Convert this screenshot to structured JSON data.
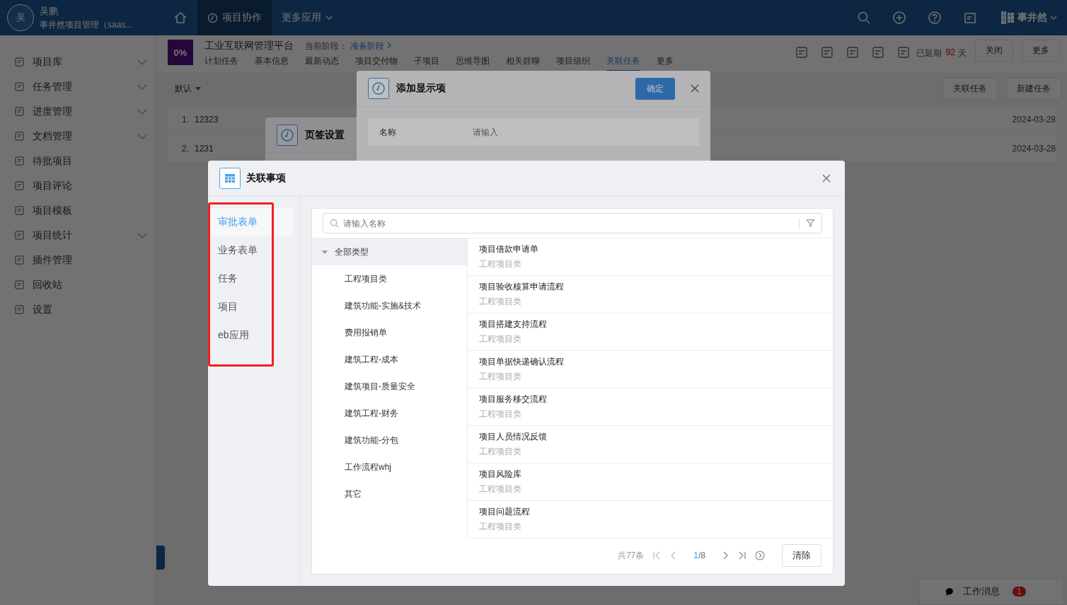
{
  "topbar": {
    "avatar": "吴",
    "user": "吴鹏",
    "company": "事井然项目管理（saas...",
    "nav": [
      {
        "label": "项目协作",
        "selected": true
      },
      {
        "label": "更多应用",
        "selected": false
      }
    ],
    "logo": "事井然"
  },
  "sidebar": {
    "items": [
      {
        "label": "项目库",
        "expandable": true
      },
      {
        "label": "任务管理",
        "expandable": true
      },
      {
        "label": "进度管理",
        "expandable": true
      },
      {
        "label": "文档管理",
        "expandable": true
      },
      {
        "label": "待批项目",
        "expandable": false
      },
      {
        "label": "项目评论",
        "expandable": false
      },
      {
        "label": "项目模板",
        "expandable": false
      },
      {
        "label": "项目统计",
        "expandable": true
      },
      {
        "label": "插件管理",
        "expandable": false
      },
      {
        "label": "回收站",
        "expandable": false
      },
      {
        "label": "设置",
        "expandable": false
      }
    ]
  },
  "project": {
    "progress": "0%",
    "title": "工业互联网管理平台",
    "stage_label": "当前阶段：",
    "stage": "准备阶段",
    "tabs": [
      {
        "label": "计划任务",
        "selected": false
      },
      {
        "label": "基本信息",
        "selected": false
      },
      {
        "label": "最新动态",
        "selected": false
      },
      {
        "label": "项目交付物",
        "selected": false
      },
      {
        "label": "子项目",
        "selected": false
      },
      {
        "label": "思维导图",
        "selected": false
      },
      {
        "label": "相关群聊",
        "selected": false
      },
      {
        "label": "项目组织",
        "selected": false
      },
      {
        "label": "关联任务",
        "selected": true
      },
      {
        "label": "更多",
        "selected": false
      }
    ],
    "delay_label": "已延期",
    "delay_days": "92",
    "delay_unit": "天",
    "buttons": [
      "关闭",
      "更多"
    ]
  },
  "toolbar": {
    "sort": "默认",
    "buttons": [
      "关联任务",
      "新建任务"
    ]
  },
  "tasks": [
    {
      "index": "1.",
      "name": "12323",
      "date": "2024-03-28"
    },
    {
      "index": "2.",
      "name": "1231",
      "date": "2024-03-28"
    }
  ],
  "messages": {
    "label": "工作消息",
    "count": "1"
  },
  "tab_settings_dialog": {
    "title": "页签设置"
  },
  "add_item_dialog": {
    "title": "添加显示项",
    "confirm": "确定",
    "fields": [
      {
        "label": "名称",
        "placeholder": "请输入"
      }
    ]
  },
  "link_dialog": {
    "title": "关联事项",
    "categories": [
      {
        "label": "审批表单",
        "selected": true
      },
      {
        "label": "业务表单",
        "selected": false
      },
      {
        "label": "任务",
        "selected": false
      },
      {
        "label": "项目",
        "selected": false
      },
      {
        "label": "eb应用",
        "selected": false
      }
    ],
    "search": {
      "placeholder": "请输入名称"
    },
    "tree": {
      "label": "全部类型",
      "expanded": true,
      "selected": true,
      "children": [
        {
          "label": "工程项目类",
          "selected": false
        },
        {
          "label": "建筑功能-实施&技术",
          "selected": false
        },
        {
          "label": "费用报销单",
          "selected": false
        },
        {
          "label": "建筑工程-成本",
          "selected": false
        },
        {
          "label": "建筑项目-质量安全",
          "selected": false
        },
        {
          "label": "建筑工程-财务",
          "selected": false
        },
        {
          "label": "建筑功能-分包",
          "selected": false
        },
        {
          "label": "工作流程whj",
          "selected": false
        },
        {
          "label": "其它",
          "selected": false
        }
      ]
    },
    "items": [
      {
        "title": "项目借款申请单",
        "type": "工程项目类"
      },
      {
        "title": "项目验收核算申请流程",
        "type": "工程项目类"
      },
      {
        "title": "项目搭建支持流程",
        "type": "工程项目类"
      },
      {
        "title": "项目单据快递确认流程",
        "type": "工程项目类"
      },
      {
        "title": "项目服务移交流程",
        "type": "工程项目类"
      },
      {
        "title": "项目人员情况反馈",
        "type": "工程项目类"
      },
      {
        "title": "项目风险库",
        "type": "工程项目类"
      },
      {
        "title": "项目问题流程",
        "type": "工程项目类"
      }
    ],
    "pagination": {
      "total": "共77条",
      "current": "1",
      "pages": "/8"
    },
    "clear": "清除"
  }
}
